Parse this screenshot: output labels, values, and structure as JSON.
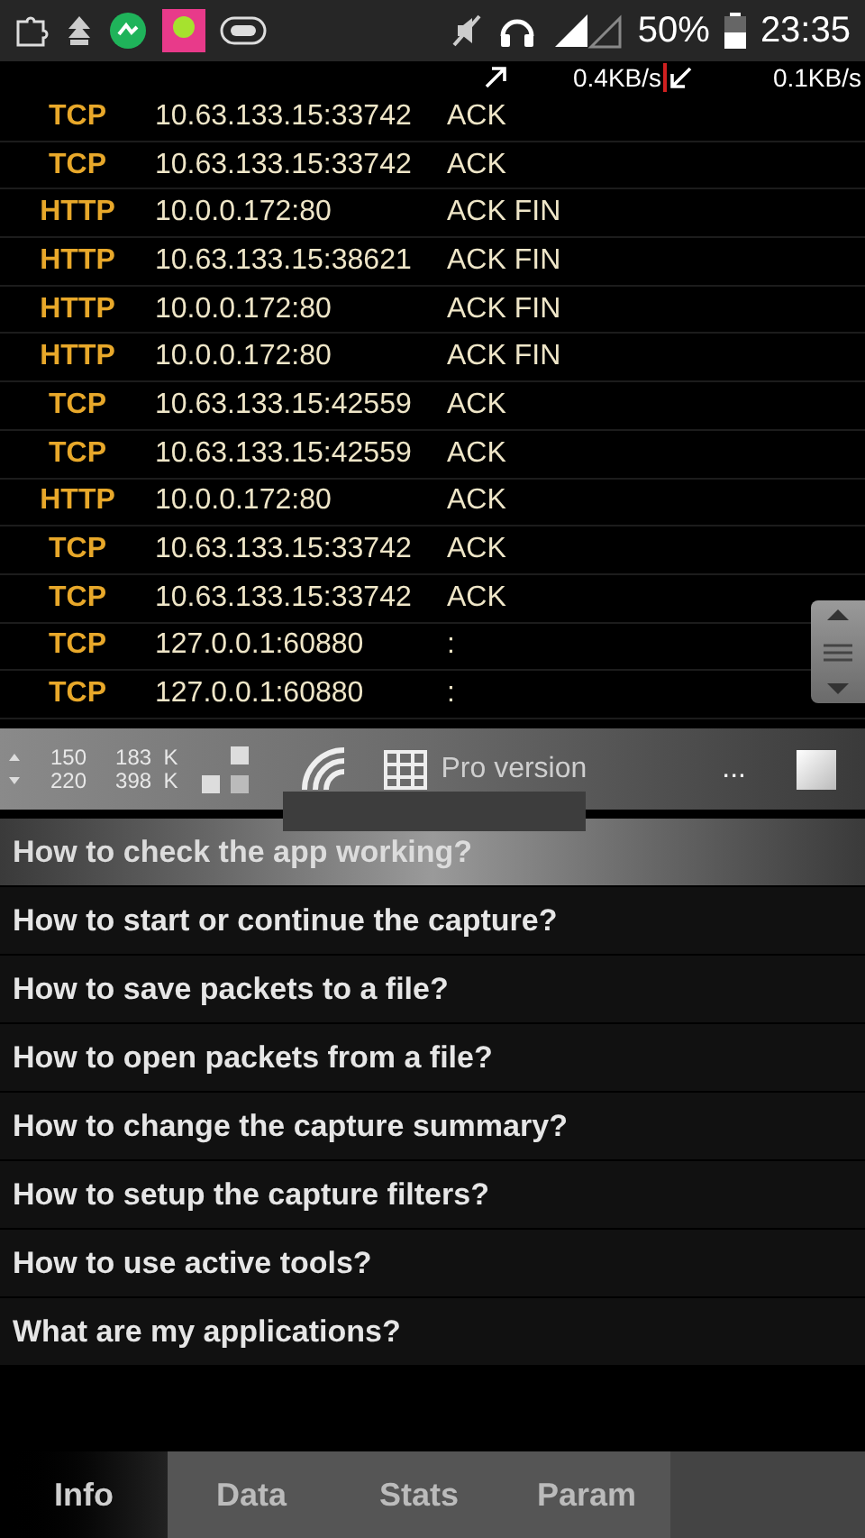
{
  "status_bar": {
    "battery": "50%",
    "time": "23:35"
  },
  "speed_bar": {
    "upload": "0.4KB/s",
    "download": "0.1KB/s"
  },
  "packets": [
    {
      "protocol": "TCP",
      "address": "10.63.133.15:33742",
      "flags": "ACK"
    },
    {
      "protocol": "TCP",
      "address": "10.63.133.15:33742",
      "flags": "ACK"
    },
    {
      "protocol": "HTTP",
      "address": "10.0.0.172:80",
      "flags": "ACK FIN"
    },
    {
      "protocol": "HTTP",
      "address": "10.63.133.15:38621",
      "flags": "ACK FIN"
    },
    {
      "protocol": "HTTP",
      "address": "10.0.0.172:80",
      "flags": "ACK FIN"
    },
    {
      "protocol": "HTTP",
      "address": "10.0.0.172:80",
      "flags": "ACK FIN"
    },
    {
      "protocol": "TCP",
      "address": "10.63.133.15:42559",
      "flags": "ACK"
    },
    {
      "protocol": "TCP",
      "address": "10.63.133.15:42559",
      "flags": "ACK"
    },
    {
      "protocol": "HTTP",
      "address": "10.0.0.172:80",
      "flags": "ACK"
    },
    {
      "protocol": "TCP",
      "address": "10.63.133.15:33742",
      "flags": "ACK"
    },
    {
      "protocol": "TCP",
      "address": "10.63.133.15:33742",
      "flags": "ACK"
    },
    {
      "protocol": "TCP",
      "address": "127.0.0.1:60880",
      "flags": ":"
    },
    {
      "protocol": "TCP",
      "address": "127.0.0.1:60880",
      "flags": ":"
    }
  ],
  "toolbar": {
    "packets_up": "150",
    "packets_down": "220",
    "bytes_up": "183  K",
    "bytes_down": "398  K",
    "pro_label": "Pro version",
    "more": "..."
  },
  "help_items": [
    {
      "label": "How to check the app working?",
      "selected": true
    },
    {
      "label": "How to start or continue the capture?",
      "selected": false
    },
    {
      "label": "How to save packets to a file?",
      "selected": false
    },
    {
      "label": "How to open packets from a file?",
      "selected": false
    },
    {
      "label": "How to change the capture summary?",
      "selected": false
    },
    {
      "label": "How to setup the capture filters?",
      "selected": false
    },
    {
      "label": "How to use active tools?",
      "selected": false
    },
    {
      "label": "What are my applications?",
      "selected": false
    }
  ],
  "tabs": [
    {
      "label": "Info",
      "selected": true
    },
    {
      "label": "Data",
      "selected": false
    },
    {
      "label": "Stats",
      "selected": false
    },
    {
      "label": "Param",
      "selected": false
    }
  ]
}
